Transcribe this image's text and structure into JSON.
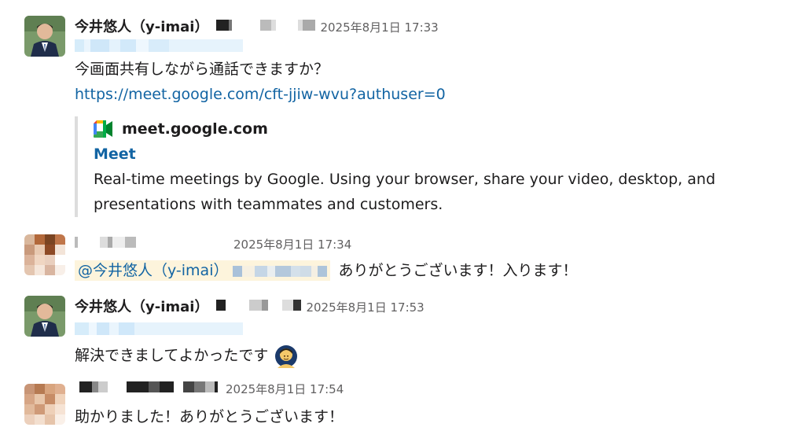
{
  "messages": [
    {
      "author": "今井悠人（y-imai）",
      "timestamp": "2025年8月1日 17:33",
      "text": "今画面共有しながら通話できますか？",
      "link": "https://meet.google.com/cft-jjiw-wvu?authuser=0",
      "unfurl": {
        "site": "meet.google.com",
        "title": "Meet",
        "description_line1": "Real-time meetings by Google. Using your browser, share your video, desktop, and",
        "description_line2": "presentations with teammates and customers."
      }
    },
    {
      "timestamp": "2025年8月1日 17:34",
      "mention": "@今井悠人（y-imai）",
      "text": "ありがとうございます！入ります！"
    },
    {
      "author": "今井悠人（y-imai）",
      "timestamp": "2025年8月1日 17:53",
      "text": "解決できましてよかったです",
      "emoji": "person-bowing-emoji"
    },
    {
      "timestamp": "2025年8月1日 17:54",
      "text": "助かりました！ありがとうございます！"
    }
  ],
  "colors": {
    "link": "#1264a3",
    "mention_bg": "#fdf4dc",
    "timestamp": "#616061"
  }
}
